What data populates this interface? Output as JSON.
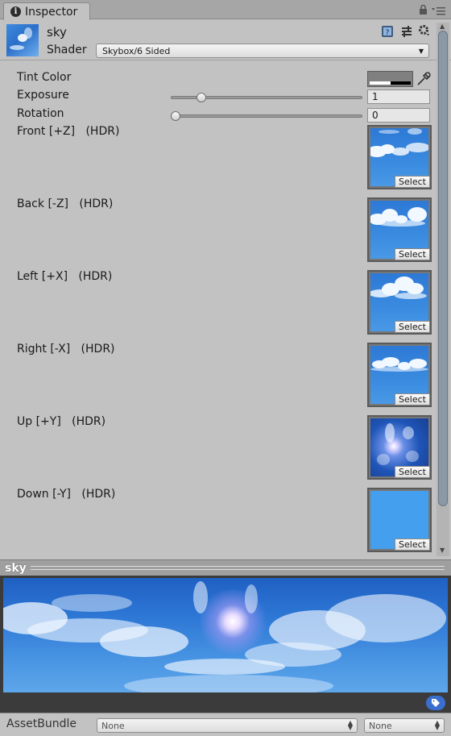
{
  "tab": {
    "icon": "info-icon",
    "title": "Inspector"
  },
  "header": {
    "asset_name": "sky",
    "shader_label": "Shader",
    "shader_value": "Skybox/6 Sided",
    "icons": [
      "help-book-icon",
      "preset-icon",
      "gear-icon"
    ]
  },
  "properties": {
    "tint_color": {
      "label": "Tint Color",
      "color": "#808080"
    },
    "exposure": {
      "label": "Exposure",
      "value": "1",
      "fraction": 0.14
    },
    "rotation": {
      "label": "Rotation",
      "value": "0",
      "fraction": 0.0
    }
  },
  "textures": [
    {
      "label": "Front [+Z]",
      "hdr": "(HDR)",
      "button": "Select"
    },
    {
      "label": "Back [-Z]",
      "hdr": "(HDR)",
      "button": "Select"
    },
    {
      "label": "Left [+X]",
      "hdr": "(HDR)",
      "button": "Select"
    },
    {
      "label": "Right [-X]",
      "hdr": "(HDR)",
      "button": "Select"
    },
    {
      "label": "Up [+Y]",
      "hdr": "(HDR)",
      "button": "Select"
    },
    {
      "label": "Down [-Y]",
      "hdr": "(HDR)",
      "button": "Select"
    }
  ],
  "preview": {
    "title": "sky"
  },
  "footer": {
    "label": "AssetBundle",
    "bundle_value": "None",
    "variant_value": "None"
  },
  "colors": {
    "accent": "#2b6fc9",
    "panel": "#c2c2c2",
    "tag_badge": "#3a6fd0"
  }
}
